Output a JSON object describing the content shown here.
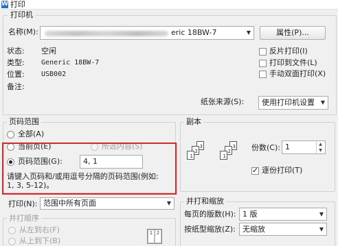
{
  "window": {
    "title": "打印",
    "icon": "wps-writer-icon"
  },
  "printer": {
    "legend": "打印机",
    "name_label": "名称(M):",
    "name_value": "eric 18BW-7",
    "properties_button": "属性(P)...",
    "status_label": "状态:",
    "status_value": "空闲",
    "type_label": "类型:",
    "type_value": "Generic 18BW-7",
    "location_label": "位置:",
    "location_value": "USB002",
    "comment_label": "备注:",
    "reverse_print": "反片打印(I)",
    "print_to_file": "打印到文件(L)",
    "manual_duplex": "手动双面打印(X)",
    "paper_source_label": "纸张来源(S):",
    "paper_source_value": "使用打印机设置"
  },
  "page_range": {
    "legend": "页码范围",
    "all": "全部(A)",
    "current_page": "当前页(E)",
    "selection": "所选内容(S)",
    "pages": "页码范围(G):",
    "pages_value": "4, 1",
    "hint": "请键入页码和/或用逗号分隔的页码范围(例如: 1, 3, 5-12)。"
  },
  "copies": {
    "legend": "副本",
    "count_label": "份数(C):",
    "count_value": "1",
    "collate": "逐份打印(T)"
  },
  "print_what": {
    "label": "打印(N):",
    "value": "范围中所有页面"
  },
  "print_order": {
    "legend": "并打顺序",
    "left_to_right": "从左到右(F)",
    "top_to_bottom": "从上到下(B)"
  },
  "scaling": {
    "legend": "并打和缩放",
    "pages_per_sheet_label": "每页的版数(H):",
    "pages_per_sheet_value": "1 版",
    "scale_label": "按纸型缩放(Z):",
    "scale_value": "无缩放"
  },
  "colors": {
    "accent": "#e8201f",
    "title_icon": "#2a6fc9"
  }
}
